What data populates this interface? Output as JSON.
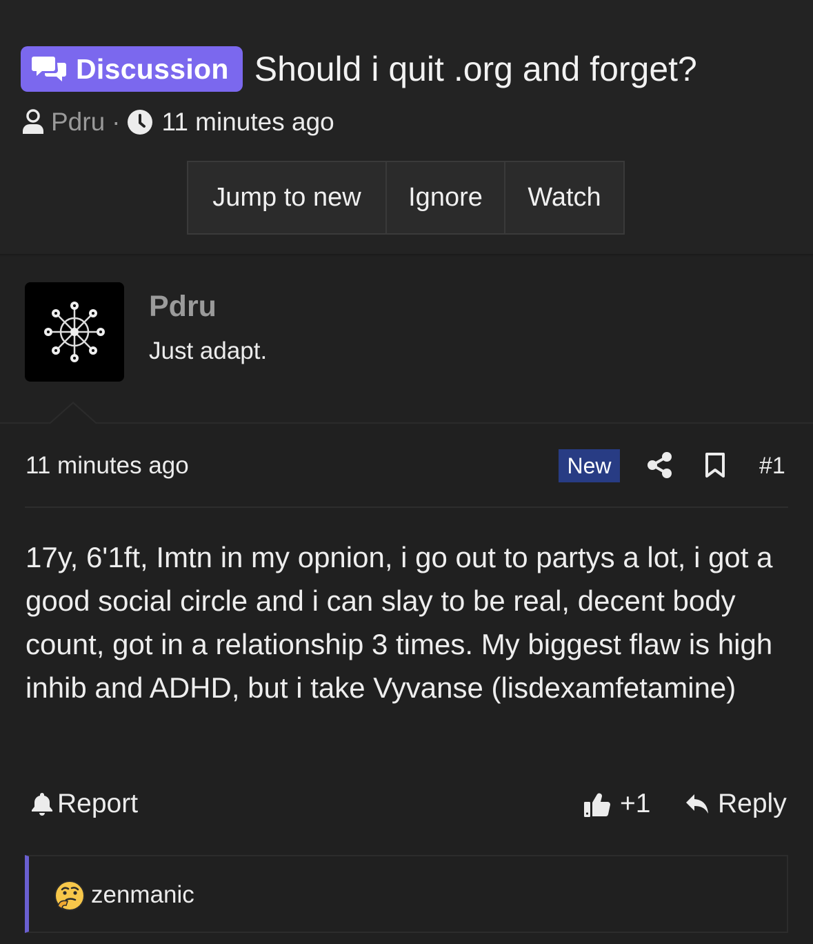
{
  "thread": {
    "tag": "Discussion",
    "title": "Should i quit .org and forget?",
    "author": "Pdru",
    "separator": "·",
    "time": "11 minutes ago"
  },
  "actions": {
    "jump": "Jump to new",
    "ignore": "Ignore",
    "watch": "Watch"
  },
  "user": {
    "name": "Pdru",
    "title": "Just adapt."
  },
  "post": {
    "time": "11 minutes ago",
    "new_label": "New",
    "number": "#1",
    "body": "17y, 6'1ft, Imtn in my opnion, i go out to partys a lot, i got a good social circle and i can slay to be real, decent body count, got in a relationship 3 times. My biggest flaw is high inhib and ADHD, but i take Vyvanse (lisdexamfetamine)",
    "report": "Report",
    "likes": "+1",
    "reply": "Reply"
  },
  "reactions": {
    "user": "zenmanic",
    "emoji": "thinking-face"
  },
  "colors": {
    "background": "#202020",
    "tag": "#7b68ee",
    "new_badge": "#283c84",
    "reaction_accent": "#6a5fd0"
  }
}
